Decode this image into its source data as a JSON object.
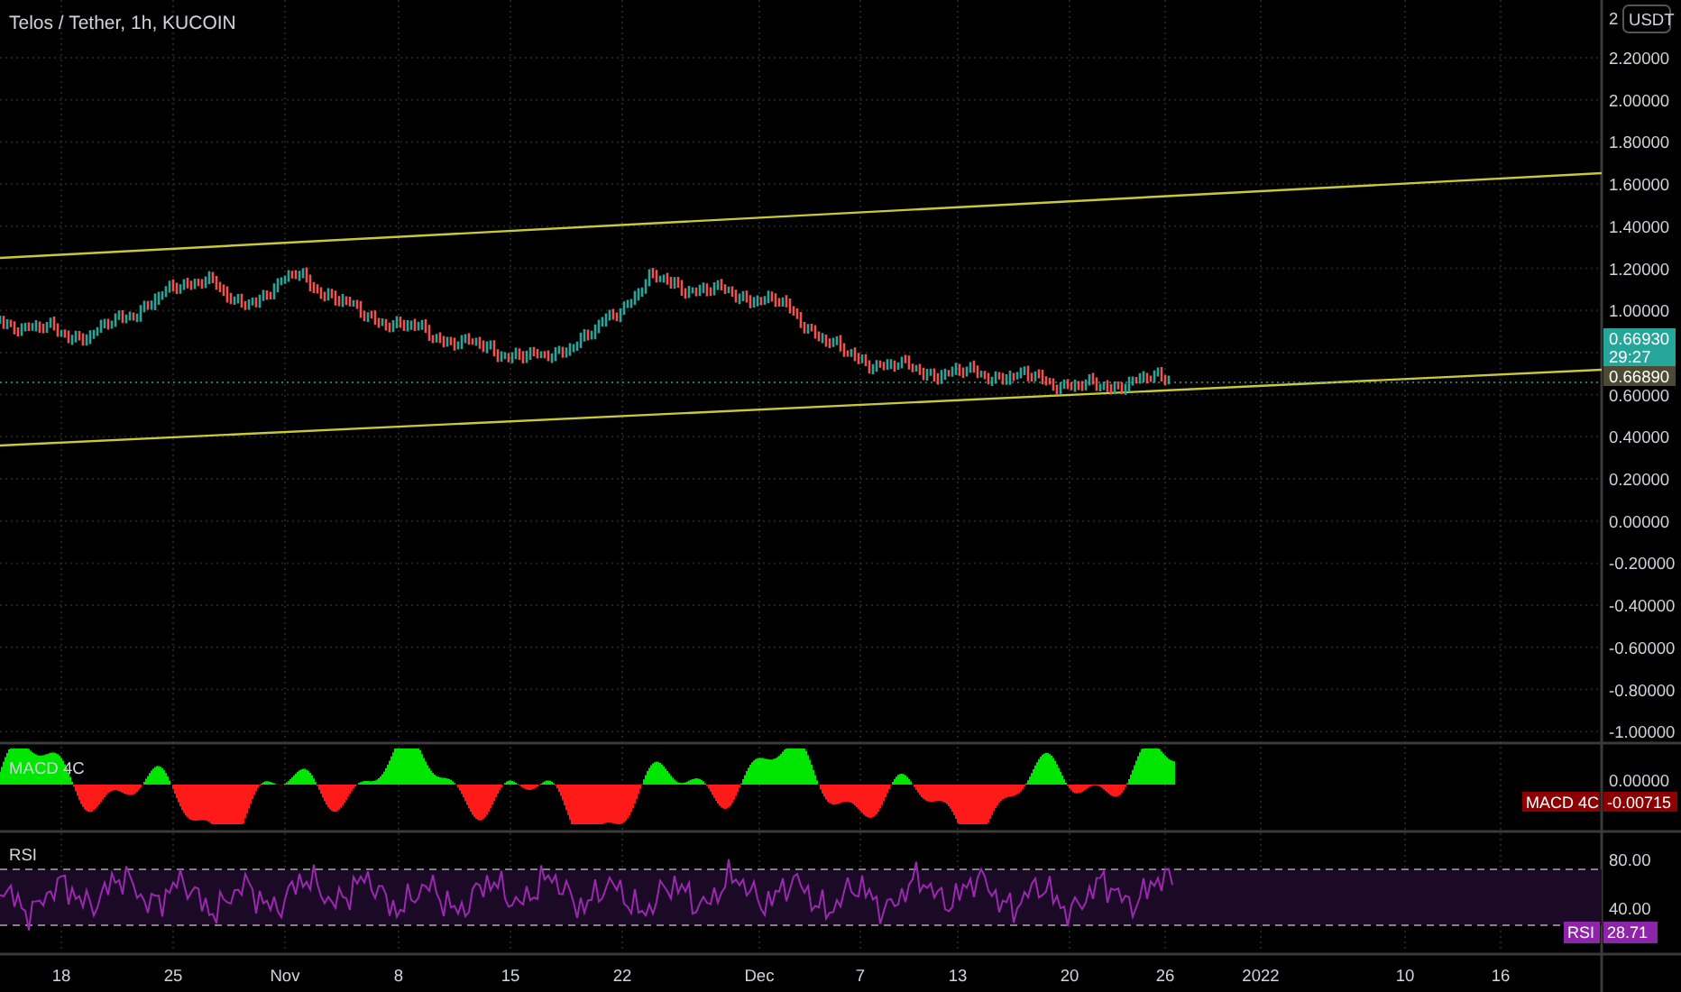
{
  "header": {
    "title": "Telos / Tether, 1h, KUCOIN"
  },
  "price_axis": {
    "currency": "USDT",
    "labels": [
      "2",
      "2.20000",
      "2.00000",
      "1.80000",
      "1.60000",
      "1.40000",
      "1.20000",
      "1.00000",
      "0.60000",
      "0.40000",
      "0.20000",
      "0.00000",
      "-0.20000",
      "-0.40000",
      "-0.60000",
      "-0.80000",
      "-1.00000"
    ]
  },
  "price_badges": [
    {
      "price": "0.66930",
      "countdown": "29:27"
    },
    {
      "price": "0.66890"
    }
  ],
  "macd": {
    "legend": "MACD 4C",
    "axis_labels": [
      "0.00000"
    ],
    "badge": {
      "name": "MACD 4C",
      "value": "-0.00715"
    }
  },
  "rsi": {
    "legend": "RSI",
    "axis_labels": [
      "80.00",
      "40.00"
    ],
    "badge": {
      "name": "RSI",
      "value": "28.71"
    }
  },
  "time_axis": {
    "labels": [
      "18",
      "25",
      "Nov",
      "8",
      "15",
      "22",
      "Dec",
      "7",
      "13",
      "20",
      "26",
      "2022",
      "10",
      "16"
    ]
  }
}
